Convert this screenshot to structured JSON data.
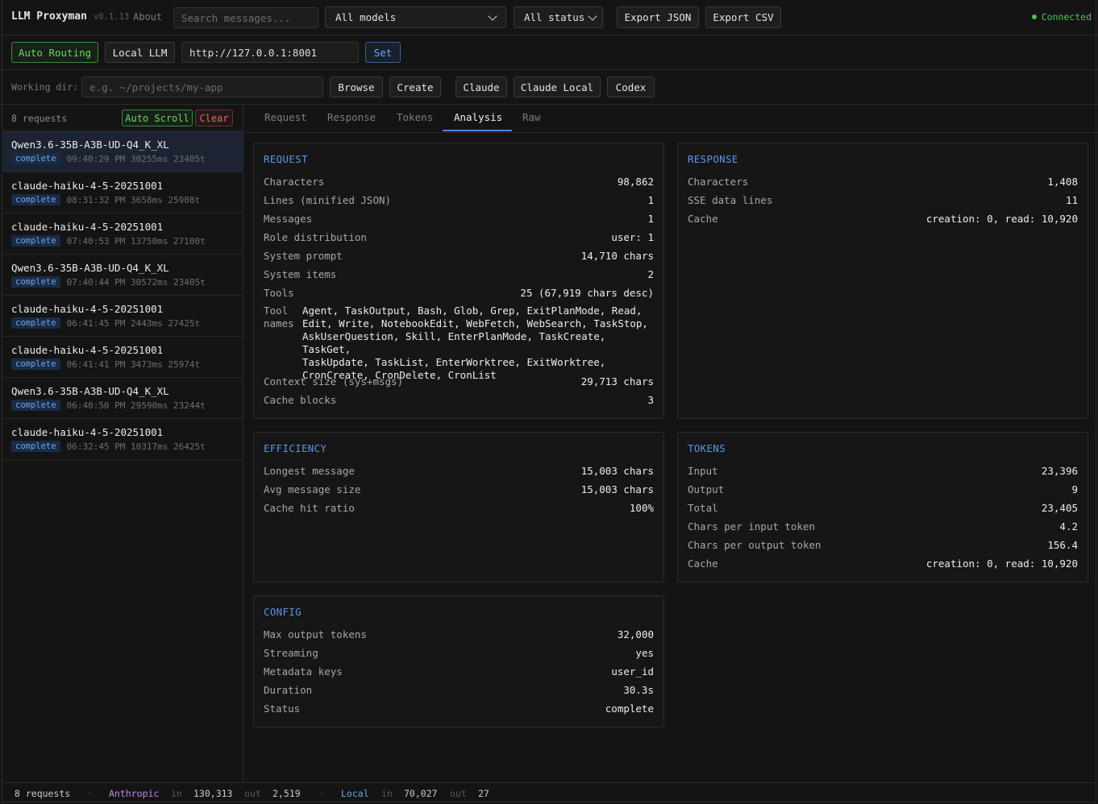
{
  "app": {
    "name": "LLM Proxyman",
    "version": "v0.1.13",
    "about": "About",
    "status": "Connected"
  },
  "toolbar": {
    "search_placeholder": "Search messages...",
    "model_filter": "All models",
    "status_filter": "All status",
    "export_json": "Export JSON",
    "export_csv": "Export CSV"
  },
  "routing": {
    "auto": "Auto Routing",
    "local": "Local LLM",
    "url": "http://127.0.0.1:8001",
    "set": "Set"
  },
  "workdir": {
    "label": "Working dir:",
    "placeholder": "e.g. ~/projects/my-app",
    "browse": "Browse",
    "create": "Create",
    "claude": "Claude",
    "claude_local": "Claude Local",
    "codex": "Codex"
  },
  "sidebar": {
    "count": "8 requests",
    "auto_scroll": "Auto Scroll",
    "clear": "Clear",
    "requests": [
      {
        "model": "Qwen3.6-35B-A3B-UD-Q4_K_XL",
        "status": "complete",
        "meta": "09:40:29 PM 30255ms 23405t"
      },
      {
        "model": "claude-haiku-4-5-20251001",
        "status": "complete",
        "meta": "08:31:32 PM 3658ms 25908t"
      },
      {
        "model": "claude-haiku-4-5-20251001",
        "status": "complete",
        "meta": "07:40:53 PM 13750ms 27100t"
      },
      {
        "model": "Qwen3.6-35B-A3B-UD-Q4_K_XL",
        "status": "complete",
        "meta": "07:40:44 PM 30572ms 23405t"
      },
      {
        "model": "claude-haiku-4-5-20251001",
        "status": "complete",
        "meta": "06:41:45 PM 2443ms 27425t"
      },
      {
        "model": "claude-haiku-4-5-20251001",
        "status": "complete",
        "meta": "06:41:41 PM 3473ms 25974t"
      },
      {
        "model": "Qwen3.6-35B-A3B-UD-Q4_K_XL",
        "status": "complete",
        "meta": "06:40:50 PM 29590ms 23244t"
      },
      {
        "model": "claude-haiku-4-5-20251001",
        "status": "complete",
        "meta": "06:32:45 PM 10317ms 26425t"
      }
    ]
  },
  "tabs": [
    "Request",
    "Response",
    "Tokens",
    "Analysis",
    "Raw"
  ],
  "request_panel": {
    "title": "REQUEST",
    "rows": [
      {
        "k": "Characters",
        "v": "98,862"
      },
      {
        "k": "Lines (minified JSON)",
        "v": "1"
      },
      {
        "k": "Messages",
        "v": "1"
      },
      {
        "k": "Role distribution",
        "v": "user: 1"
      },
      {
        "k": "System prompt",
        "v": "14,710 chars"
      },
      {
        "k": "System items",
        "v": "2"
      },
      {
        "k": "Tools",
        "v": "25 (67,919 chars desc)"
      }
    ],
    "tool_names_label": "Tool names",
    "tool_names_lines": [
      "Agent, TaskOutput, Bash, Glob, Grep, ExitPlanMode, Read,",
      "Edit, Write, NotebookEdit, WebFetch, WebSearch, TaskStop,",
      "AskUserQuestion, Skill, EnterPlanMode, TaskCreate, TaskGet,",
      "TaskUpdate, TaskList, EnterWorktree, ExitWorktree,",
      "CronCreate, CronDelete, CronList"
    ],
    "rows2": [
      {
        "k": "Context size (sys+msgs)",
        "v": "29,713 chars"
      },
      {
        "k": "Cache blocks",
        "v": "3"
      }
    ]
  },
  "response_panel": {
    "title": "RESPONSE",
    "rows": [
      {
        "k": "Characters",
        "v": "1,408"
      },
      {
        "k": "SSE data lines",
        "v": "11"
      },
      {
        "k": "Cache",
        "v": "creation: 0, read: 10,920"
      }
    ]
  },
  "efficiency_panel": {
    "title": "EFFICIENCY",
    "rows": [
      {
        "k": "Longest message",
        "v": "15,003 chars"
      },
      {
        "k": "Avg message size",
        "v": "15,003 chars"
      },
      {
        "k": "Cache hit ratio",
        "v": "100%"
      }
    ]
  },
  "tokens_panel": {
    "title": "TOKENS",
    "rows": [
      {
        "k": "Input",
        "v": "23,396"
      },
      {
        "k": "Output",
        "v": "9"
      },
      {
        "k": "Total",
        "v": "23,405"
      },
      {
        "k": "Chars per input token",
        "v": "4.2"
      },
      {
        "k": "Chars per output token",
        "v": "156.4"
      },
      {
        "k": "Cache",
        "v": "creation: 0, read: 10,920"
      }
    ]
  },
  "config_panel": {
    "title": "CONFIG",
    "rows": [
      {
        "k": "Max output tokens",
        "v": "32,000"
      },
      {
        "k": "Streaming",
        "v": "yes"
      },
      {
        "k": "Metadata keys",
        "v": "user_id"
      },
      {
        "k": "Duration",
        "v": "30.3s"
      },
      {
        "k": "Status",
        "v": "complete"
      }
    ]
  },
  "statusbar": {
    "count": "8 requests",
    "sep": "·",
    "anthropic": "Anthropic",
    "a_in_label": "in",
    "a_in": "130,313",
    "a_out_label": "out",
    "a_out": "2,519",
    "local": "Local",
    "l_in_label": "in",
    "l_in": "70,027",
    "l_out_label": "out",
    "l_out": "27"
  },
  "colors": {
    "accent": "#5b95e5",
    "green": "#52c052",
    "purple": "#c187e8",
    "red": "#e06b6b"
  }
}
